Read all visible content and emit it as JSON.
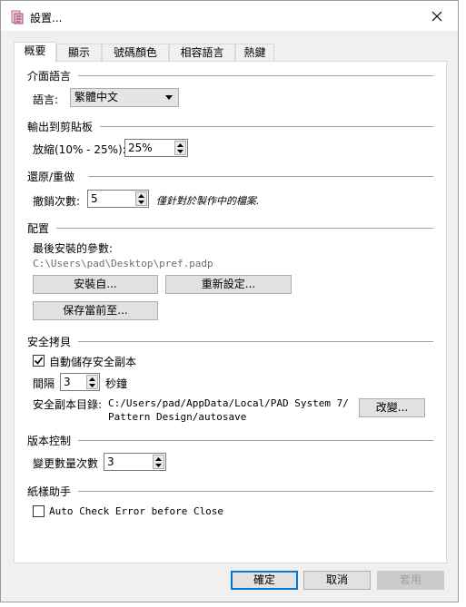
{
  "window": {
    "title": "設置..."
  },
  "tabs": [
    {
      "label": "概要",
      "active": true
    },
    {
      "label": "顯示",
      "active": false
    },
    {
      "label": "號碼顏色",
      "active": false
    },
    {
      "label": "相容語言",
      "active": false
    },
    {
      "label": "熱鍵",
      "active": false
    }
  ],
  "interface_language": {
    "group_title": "介面語言",
    "label": "語言:",
    "selected": "繁體中文"
  },
  "clipboard_output": {
    "group_title": "輸出到剪貼板",
    "label": "放縮(10% - 25%):",
    "value": "25%"
  },
  "undo_redo": {
    "group_title": "還原/重做",
    "label": "撤銷次數:",
    "value": "5",
    "note": "僅針對於製作中的檔案."
  },
  "config": {
    "group_title": "配置",
    "last_params_label": "最後安裝的參數:",
    "last_params_path": "C:\\Users\\pad\\Desktop\\pref.padp",
    "install_from": "安裝自...",
    "reset": "重新設定...",
    "save_current": "保存當前至..."
  },
  "safe_copy": {
    "group_title": "安全拷貝",
    "auto_save_label": "自動儲存安全副本",
    "auto_save_checked": true,
    "interval_label": "間隔",
    "interval_value": "3",
    "interval_unit": "秒鐘",
    "dir_label": "安全副本目錄:",
    "dir_line1": "C:/Users/pad/AppData/Local/PAD System 7/",
    "dir_line2": "Pattern Design/autosave",
    "change_button": "改變..."
  },
  "version_control": {
    "group_title": "版本控制",
    "label": "變更數量次數",
    "value": "3"
  },
  "sample_helper": {
    "group_title": "紙樣助手",
    "check_label": "Auto Check Error before Close",
    "checked": false
  },
  "footer": {
    "ok": "確定",
    "cancel": "取消",
    "apply": "套用"
  }
}
